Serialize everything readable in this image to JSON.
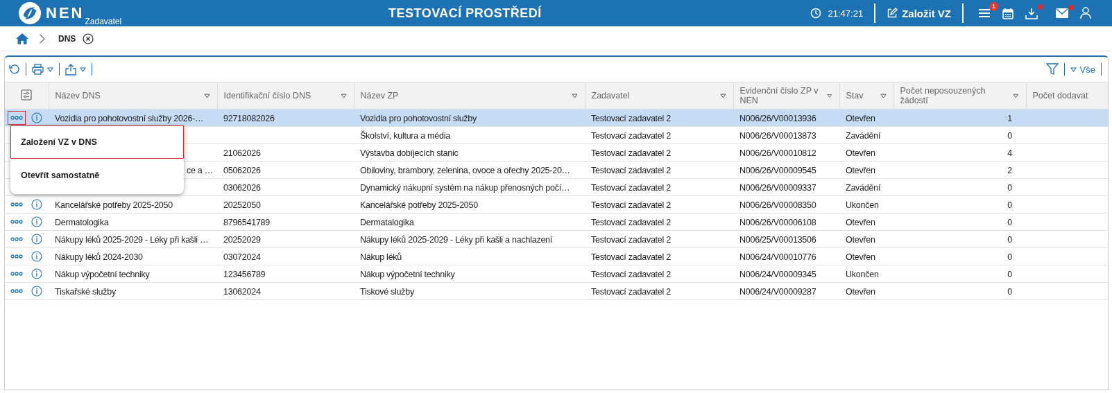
{
  "topbar": {
    "logo": "NEN",
    "subtitle": "Zadavatel",
    "environment": "TESTOVACÍ PROSTŘEDÍ",
    "time": "21:47:21",
    "create_button": "Založit VZ",
    "menu_badge": "1",
    "download_alert": true,
    "mail_alert": true
  },
  "breadcrumb": {
    "current": "DNS"
  },
  "toolbar": {
    "filter_label": "Vše"
  },
  "columns": [
    {
      "label": "Název DNS",
      "sortable": true
    },
    {
      "label": "Identifikační číslo DNS",
      "sortable": true
    },
    {
      "label": "Název ZP",
      "sortable": true
    },
    {
      "label": "Zadavatel",
      "sortable": true
    },
    {
      "label": "Evidenční číslo ZP v NEN",
      "sortable": true
    },
    {
      "label": "Stav",
      "sortable": true
    },
    {
      "label": "Počet neposouzených žádostí",
      "sortable": true
    },
    {
      "label": "Počet dodavat",
      "sortable": false
    }
  ],
  "rows": [
    {
      "selected": true,
      "actions": true,
      "actions_focused": true,
      "name": "Vozidla pro pohotovostní služby 2026-…",
      "cells": [
        "92718082026",
        "Vozidla pro pohotovostní služby",
        "Testovací zadavatel 2",
        "N006/26/V00013936",
        "Otevřen",
        "1"
      ]
    },
    {
      "selected": false,
      "actions": false,
      "cells": [
        "",
        "Školství, kultura a média",
        "Testovací zadavatel 2",
        "N006/26/V00013873",
        "Zavádění",
        "0"
      ]
    },
    {
      "selected": false,
      "actions": false,
      "cells": [
        "21062026",
        "Výstavba dobíjecích stanic",
        "Testovací zadavatel 2",
        "N006/26/V00010812",
        "Otevřen",
        "4"
      ]
    },
    {
      "selected": false,
      "actions": false,
      "name_tail": "ce a …",
      "cells": [
        "05062026",
        "Obiloviny, brambory, zelenina, ovoce a ořechy 2025-20…",
        "Testovací zadavatel 2",
        "N006/26/V00009545",
        "Otevřen",
        "2"
      ]
    },
    {
      "selected": false,
      "actions": false,
      "cells": [
        "03062026",
        "Dynamický nákupní systém na nákup přenosných počí…",
        "Testovací zadavatel 2",
        "N006/26/V00009337",
        "Zavádění",
        "0"
      ]
    },
    {
      "selected": false,
      "actions": true,
      "actions_focused": false,
      "name": "Kancelářské potřeby 2025-2050",
      "cells": [
        "20252050",
        "Kancelářské potřeby 2025-2050",
        "Testovací zadavatel 2",
        "N006/26/V00008350",
        "Ukončen",
        "0"
      ]
    },
    {
      "selected": false,
      "actions": true,
      "actions_focused": false,
      "name": "Dermatologika",
      "cells": [
        "8796541789",
        "Dermatalogika",
        "Testovací zadavatel 2",
        "N006/26/V00006108",
        "Otevřen",
        "0"
      ]
    },
    {
      "selected": false,
      "actions": true,
      "actions_focused": false,
      "name": "Nákupy léků 2025-2029 - Léky při kašli …",
      "cells": [
        "20252029",
        "Nákupy léků 2025-2029 - Léky při kašli a nachlazení",
        "Testovací zadavatel 2",
        "N006/25/V00013506",
        "Otevřen",
        "0"
      ]
    },
    {
      "selected": false,
      "actions": true,
      "actions_focused": false,
      "name": "Nákupy léků 2024-2030",
      "cells": [
        "03072024",
        "Nákup léků",
        "Testovací zadavatel 2",
        "N006/24/V00010776",
        "Otevřen",
        "0"
      ]
    },
    {
      "selected": false,
      "actions": true,
      "actions_focused": false,
      "name": "Nákup výpočetní techniky",
      "cells": [
        "123456789",
        "Nákup výpočetní techniky",
        "Testovací zadavatel 2",
        "N006/24/V00009345",
        "Ukončen",
        "0"
      ]
    },
    {
      "selected": false,
      "actions": true,
      "actions_focused": false,
      "name": "Tiskařské služby",
      "cells": [
        "13062024",
        "Tiskové služby",
        "Testovací zadavatel 2",
        "N006/24/V00009287",
        "Otevřen",
        "0"
      ]
    }
  ],
  "context_menu": [
    {
      "label": "Založení VZ v DNS",
      "selected": true
    },
    {
      "label": "Otevřít samostatně",
      "selected": false
    }
  ]
}
